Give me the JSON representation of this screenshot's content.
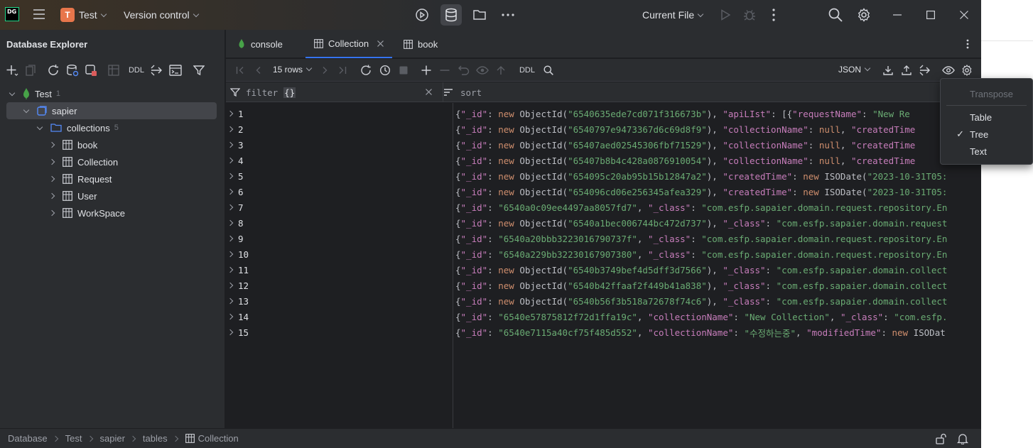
{
  "titlebar": {
    "logo_text": "DG",
    "project_badge": "T",
    "project_name": "Test",
    "version_control": "Version control",
    "current_file": "Current File"
  },
  "sidebar": {
    "title": "Database Explorer",
    "toolbar_ddl": "DDL",
    "tree": [
      {
        "label": "Test",
        "count": "1"
      },
      {
        "label": "sapier"
      },
      {
        "label": "collections",
        "count": "5"
      },
      {
        "label": "book"
      },
      {
        "label": "Collection"
      },
      {
        "label": "Request"
      },
      {
        "label": "User"
      },
      {
        "label": "WorkSpace"
      }
    ]
  },
  "tabs": [
    {
      "label": "console"
    },
    {
      "label": "Collection"
    },
    {
      "label": "book"
    }
  ],
  "toolbar": {
    "rows": "15 rows",
    "ddl": "DDL",
    "format": "JSON"
  },
  "filter": {
    "filter_label": "filter",
    "filter_brace": "{}",
    "sort_label": "sort"
  },
  "rows": [
    {
      "n": "1",
      "parts": [
        [
          "p",
          "{"
        ],
        [
          "k",
          "\"_id\""
        ],
        [
          "p",
          ": "
        ],
        [
          "w",
          "new "
        ],
        [
          "p",
          "ObjectId("
        ],
        [
          "s",
          "\"6540635ede7cd071f316673b\""
        ],
        [
          "p",
          "), "
        ],
        [
          "k",
          "\"apiLIst\""
        ],
        [
          "p",
          ": [{"
        ],
        [
          "k",
          "\"requestName\""
        ],
        [
          "p",
          ": "
        ],
        [
          "s",
          "\"New Re"
        ]
      ]
    },
    {
      "n": "2",
      "parts": [
        [
          "p",
          "{"
        ],
        [
          "k",
          "\"_id\""
        ],
        [
          "p",
          ": "
        ],
        [
          "w",
          "new "
        ],
        [
          "p",
          "ObjectId("
        ],
        [
          "s",
          "\"6540797e9473367d6c69d8f9\""
        ],
        [
          "p",
          "), "
        ],
        [
          "k",
          "\"collectionName\""
        ],
        [
          "p",
          ": "
        ],
        [
          "w",
          "null"
        ],
        [
          "p",
          ", "
        ],
        [
          "k",
          "\"createdTime"
        ]
      ]
    },
    {
      "n": "3",
      "parts": [
        [
          "p",
          "{"
        ],
        [
          "k",
          "\"_id\""
        ],
        [
          "p",
          ": "
        ],
        [
          "w",
          "new "
        ],
        [
          "p",
          "ObjectId("
        ],
        [
          "s",
          "\"65407aed02545306fbf71529\""
        ],
        [
          "p",
          "), "
        ],
        [
          "k",
          "\"collectionName\""
        ],
        [
          "p",
          ": "
        ],
        [
          "w",
          "null"
        ],
        [
          "p",
          ", "
        ],
        [
          "k",
          "\"createdTime"
        ]
      ]
    },
    {
      "n": "4",
      "parts": [
        [
          "p",
          "{"
        ],
        [
          "k",
          "\"_id\""
        ],
        [
          "p",
          ": "
        ],
        [
          "w",
          "new "
        ],
        [
          "p",
          "ObjectId("
        ],
        [
          "s",
          "\"65407b8b4c428a0876910054\""
        ],
        [
          "p",
          "), "
        ],
        [
          "k",
          "\"collectionName\""
        ],
        [
          "p",
          ": "
        ],
        [
          "w",
          "null"
        ],
        [
          "p",
          ", "
        ],
        [
          "k",
          "\"createdTime"
        ]
      ]
    },
    {
      "n": "5",
      "parts": [
        [
          "p",
          "{"
        ],
        [
          "k",
          "\"_id\""
        ],
        [
          "p",
          ": "
        ],
        [
          "w",
          "new "
        ],
        [
          "p",
          "ObjectId("
        ],
        [
          "s",
          "\"654095c20ab95b15b12847a2\""
        ],
        [
          "p",
          "), "
        ],
        [
          "k",
          "\"createdTime\""
        ],
        [
          "p",
          ": "
        ],
        [
          "w",
          "new "
        ],
        [
          "p",
          "ISODate("
        ],
        [
          "s",
          "\"2023-10-31T05:"
        ]
      ]
    },
    {
      "n": "6",
      "parts": [
        [
          "p",
          "{"
        ],
        [
          "k",
          "\"_id\""
        ],
        [
          "p",
          ": "
        ],
        [
          "w",
          "new "
        ],
        [
          "p",
          "ObjectId("
        ],
        [
          "s",
          "\"654096cd06e256345afea329\""
        ],
        [
          "p",
          "), "
        ],
        [
          "k",
          "\"createdTime\""
        ],
        [
          "p",
          ": "
        ],
        [
          "w",
          "new "
        ],
        [
          "p",
          "ISODate("
        ],
        [
          "s",
          "\"2023-10-31T05:"
        ]
      ]
    },
    {
      "n": "7",
      "parts": [
        [
          "p",
          "{"
        ],
        [
          "k",
          "\"_id\""
        ],
        [
          "p",
          ": "
        ],
        [
          "s",
          "\"6540a0c09ee4497aa8057fd7\""
        ],
        [
          "p",
          ", "
        ],
        [
          "k",
          "\"_class\""
        ],
        [
          "p",
          ": "
        ],
        [
          "s",
          "\"com.esfp.sapaier.domain.request.repository.En"
        ]
      ]
    },
    {
      "n": "8",
      "parts": [
        [
          "p",
          "{"
        ],
        [
          "k",
          "\"_id\""
        ],
        [
          "p",
          ": "
        ],
        [
          "w",
          "new "
        ],
        [
          "p",
          "ObjectId("
        ],
        [
          "s",
          "\"6540a1bec006744bc472d737\""
        ],
        [
          "p",
          "), "
        ],
        [
          "k",
          "\"_class\""
        ],
        [
          "p",
          ": "
        ],
        [
          "s",
          "\"com.esfp.sapaier.domain.request"
        ]
      ]
    },
    {
      "n": "9",
      "parts": [
        [
          "p",
          "{"
        ],
        [
          "k",
          "\"_id\""
        ],
        [
          "p",
          ": "
        ],
        [
          "s",
          "\"6540a20bbb3223016790737f\""
        ],
        [
          "p",
          ", "
        ],
        [
          "k",
          "\"_class\""
        ],
        [
          "p",
          ": "
        ],
        [
          "s",
          "\"com.esfp.sapaier.domain.request.repository.En"
        ]
      ]
    },
    {
      "n": "10",
      "parts": [
        [
          "p",
          "{"
        ],
        [
          "k",
          "\"_id\""
        ],
        [
          "p",
          ": "
        ],
        [
          "s",
          "\"6540a229bb32230167907380\""
        ],
        [
          "p",
          ", "
        ],
        [
          "k",
          "\"_class\""
        ],
        [
          "p",
          ": "
        ],
        [
          "s",
          "\"com.esfp.sapaier.domain.request.repository.En"
        ]
      ]
    },
    {
      "n": "11",
      "parts": [
        [
          "p",
          "{"
        ],
        [
          "k",
          "\"_id\""
        ],
        [
          "p",
          ": "
        ],
        [
          "w",
          "new "
        ],
        [
          "p",
          "ObjectId("
        ],
        [
          "s",
          "\"6540b3749bef4d5dff3d7566\""
        ],
        [
          "p",
          "), "
        ],
        [
          "k",
          "\"_class\""
        ],
        [
          "p",
          ": "
        ],
        [
          "s",
          "\"com.esfp.sapaier.domain.collect"
        ]
      ]
    },
    {
      "n": "12",
      "parts": [
        [
          "p",
          "{"
        ],
        [
          "k",
          "\"_id\""
        ],
        [
          "p",
          ": "
        ],
        [
          "w",
          "new "
        ],
        [
          "p",
          "ObjectId("
        ],
        [
          "s",
          "\"6540b42ffaaf2f449b41a838\""
        ],
        [
          "p",
          "), "
        ],
        [
          "k",
          "\"_class\""
        ],
        [
          "p",
          ": "
        ],
        [
          "s",
          "\"com.esfp.sapaier.domain.collect"
        ]
      ]
    },
    {
      "n": "13",
      "parts": [
        [
          "p",
          "{"
        ],
        [
          "k",
          "\"_id\""
        ],
        [
          "p",
          ": "
        ],
        [
          "w",
          "new "
        ],
        [
          "p",
          "ObjectId("
        ],
        [
          "s",
          "\"6540b56f3b518a72678f74c6\""
        ],
        [
          "p",
          "), "
        ],
        [
          "k",
          "\"_class\""
        ],
        [
          "p",
          ": "
        ],
        [
          "s",
          "\"com.esfp.sapaier.domain.collect"
        ]
      ]
    },
    {
      "n": "14",
      "parts": [
        [
          "p",
          "{"
        ],
        [
          "k",
          "\"_id\""
        ],
        [
          "p",
          ": "
        ],
        [
          "s",
          "\"6540e57875812f72d1ffa19c\""
        ],
        [
          "p",
          ", "
        ],
        [
          "k",
          "\"collectionName\""
        ],
        [
          "p",
          ": "
        ],
        [
          "s",
          "\"New Collection\""
        ],
        [
          "p",
          ", "
        ],
        [
          "k",
          "\"_class\""
        ],
        [
          "p",
          ": "
        ],
        [
          "s",
          "\"com.esfp."
        ]
      ]
    },
    {
      "n": "15",
      "parts": [
        [
          "p",
          "{"
        ],
        [
          "k",
          "\"_id\""
        ],
        [
          "p",
          ": "
        ],
        [
          "s",
          "\"6540e7115a40cf75f485d552\""
        ],
        [
          "p",
          ", "
        ],
        [
          "k",
          "\"collectionName\""
        ],
        [
          "p",
          ": "
        ],
        [
          "s",
          "\"수정하는중\""
        ],
        [
          "p",
          ", "
        ],
        [
          "k",
          "\"modifiedTime\""
        ],
        [
          "p",
          ": "
        ],
        [
          "w",
          "new "
        ],
        [
          "p",
          "ISODat"
        ]
      ]
    }
  ],
  "view_menu": {
    "transpose": "Transpose",
    "items": [
      {
        "label": "Table",
        "checked": false
      },
      {
        "label": "Tree",
        "checked": true
      },
      {
        "label": "Text",
        "checked": false
      }
    ],
    "check_mark": "✓"
  },
  "statusbar": {
    "breadcrumbs": [
      "Database",
      "Test",
      "sapier",
      "tables",
      "Collection"
    ]
  },
  "colors": {
    "accent": "#3574f0",
    "mongo_leaf": "#47a248",
    "key": "#c77dbb",
    "string": "#6aab73",
    "keyword": "#cf8e6d"
  }
}
